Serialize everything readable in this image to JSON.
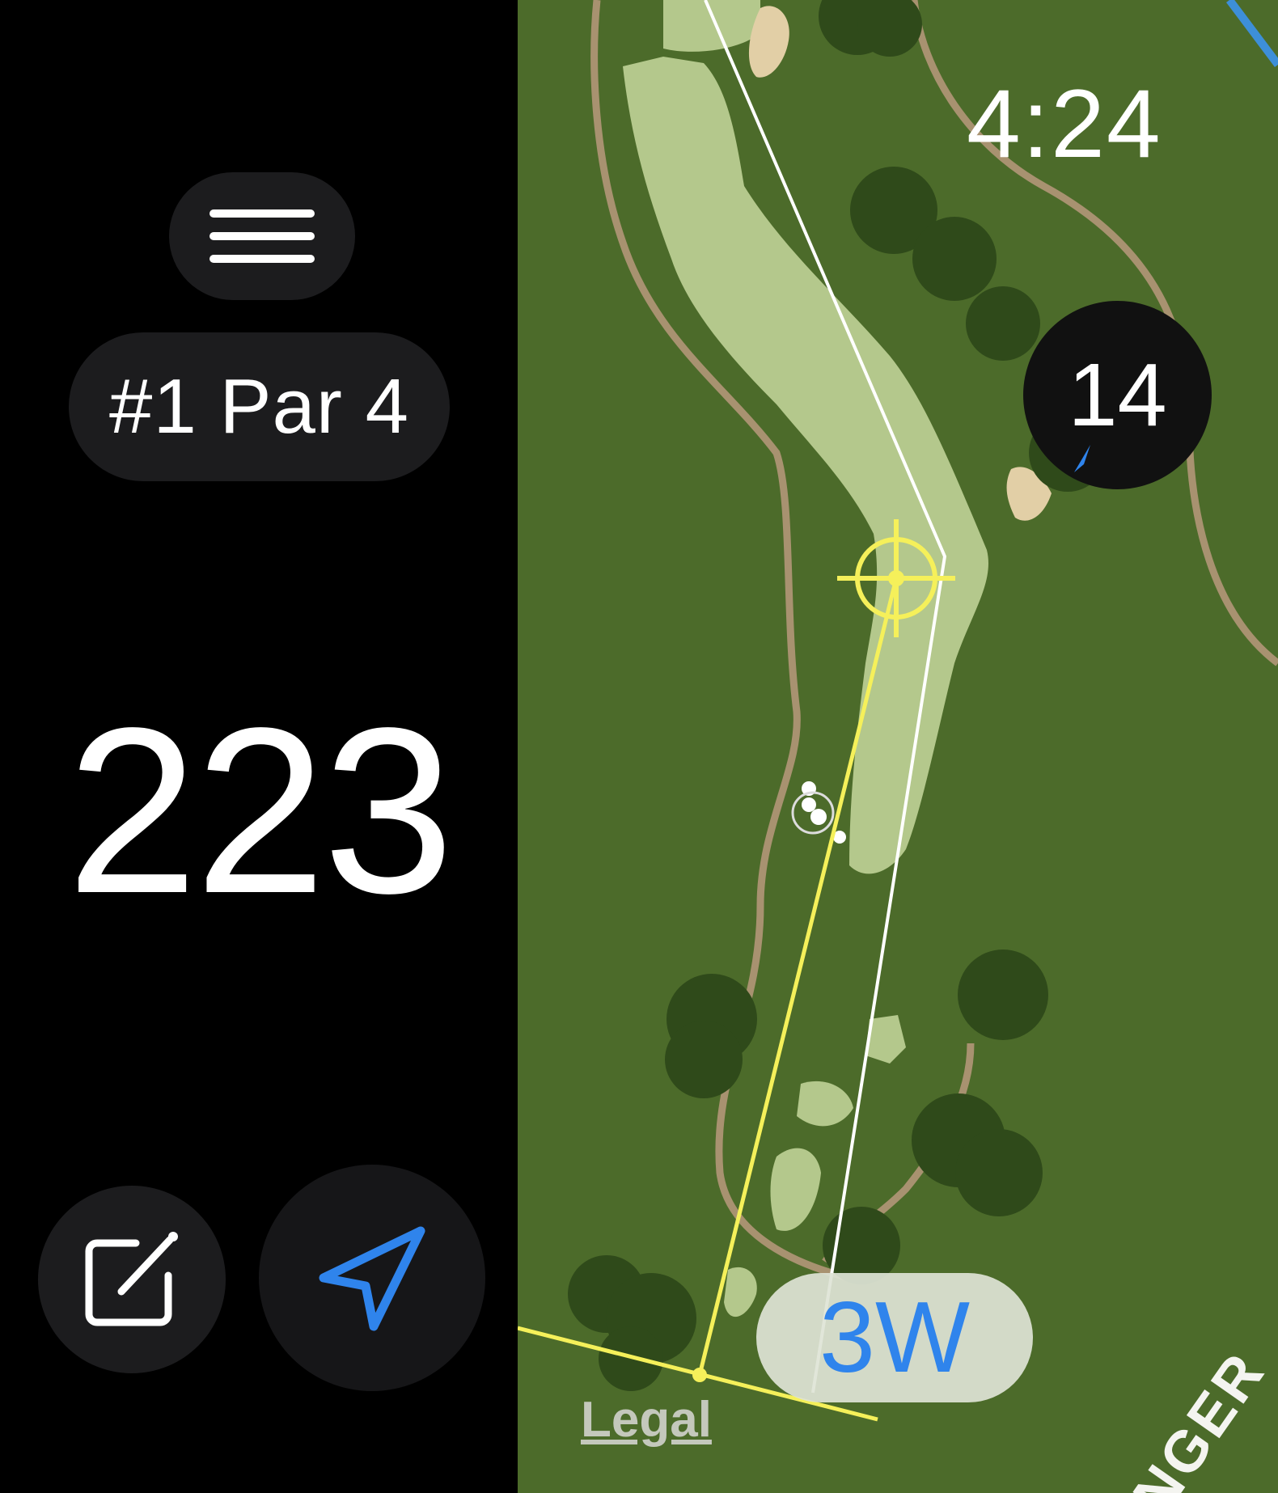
{
  "menu": {
    "icon": "hamburger-menu-icon"
  },
  "hole": {
    "label": "#1 Par 4",
    "number": 1,
    "par": 4
  },
  "distance": {
    "value": "223"
  },
  "actions": {
    "scorecard_icon": "square-and-pencil-icon",
    "location_icon": "location-arrow-icon",
    "location_color": "#2f84ec"
  },
  "map": {
    "clock": "4:24",
    "wind_speed": "14",
    "club": "3W",
    "legal": "Legal",
    "road_label": "NGER",
    "colors": {
      "rough": "#4c6b2a",
      "fairway": "#b4c88c",
      "tree": "#2f4a1a",
      "bunker": "#e2cfa6",
      "cart_path": "#a89270",
      "aim_line": "#f5f05a",
      "accent_blue": "#2f84ec"
    }
  }
}
